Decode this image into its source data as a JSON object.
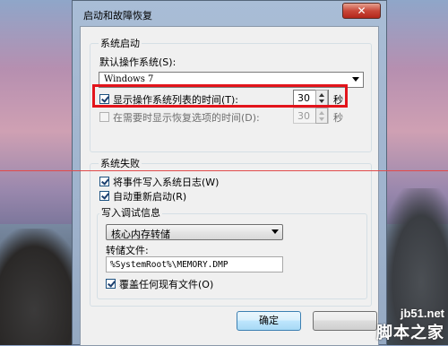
{
  "window": {
    "title": "启动和故障恢复",
    "close_glyph": "✕"
  },
  "system_startup": {
    "group_title": "系统启动",
    "default_os_label": "默认操作系统(S):",
    "default_os_value": "Windows 7",
    "show_os_list": {
      "label": "显示操作系统列表的时间(T):",
      "checked": true,
      "value": "30",
      "unit": "秒"
    },
    "show_recovery": {
      "label": "在需要时显示恢复选项的时间(D):",
      "checked": false,
      "value": "30",
      "unit": "秒"
    }
  },
  "system_failure": {
    "group_title": "系统失败",
    "write_event": {
      "label": "将事件写入系统日志(W)",
      "checked": true
    },
    "auto_restart": {
      "label": "自动重新启动(R)",
      "checked": true
    },
    "debug_info": {
      "group_title": "写入调试信息",
      "dump_type": "核心内存转储",
      "dump_file_label": "转储文件:",
      "dump_file_value": "%SystemRoot%\\MEMORY.DMP",
      "overwrite": {
        "label": "覆盖任何现有文件(O)",
        "checked": true
      }
    }
  },
  "buttons": {
    "ok": "确定",
    "cancel": ""
  },
  "watermark": {
    "site": "jb51.net",
    "name": "脚本之家"
  },
  "colors": {
    "highlight": "#e3141b"
  }
}
